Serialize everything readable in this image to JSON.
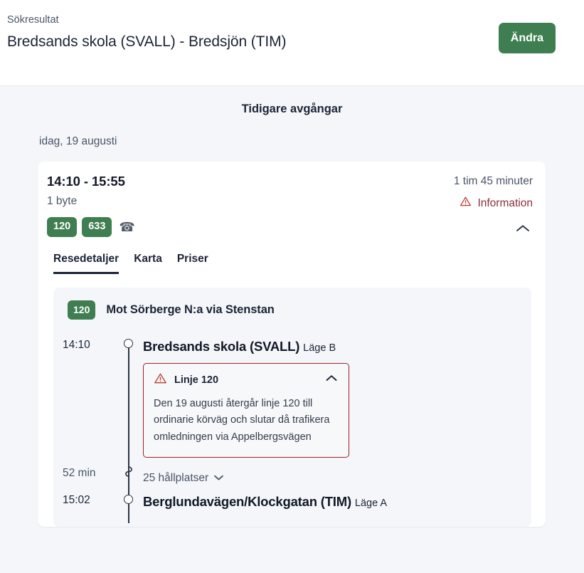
{
  "header": {
    "kicker": "Sökresultat",
    "search_title": "Bredsands skola (SVALL) - Bredsjön (TIM)",
    "change_button": "Ändra",
    "accent_green": "#3f7e51"
  },
  "results": {
    "earlier_departures": "Tidigare avgångar",
    "day_label": "idag, 19 augusti",
    "panel_background": "#f4f6f9"
  },
  "trip": {
    "times": "14:10 - 15:55",
    "changes": "1 byte",
    "duration": "1 tim 45 minuter",
    "info_label": "Information",
    "info_color": "#8c2f3d",
    "line_badges": [
      {
        "label": "120"
      },
      {
        "label": "633"
      }
    ],
    "phone_icon": "telephone-icon",
    "collapse_icon": "chevron-up-icon",
    "tabs": [
      {
        "label": "Resedetaljer",
        "active": true
      },
      {
        "label": "Karta",
        "active": false
      },
      {
        "label": "Priser",
        "active": false
      }
    ]
  },
  "leg": {
    "line_badge": "120",
    "direction": "Mot Sörberge N:a via Stenstan",
    "departure": {
      "time": "14:10",
      "stop_name": "Bredsands skola (SVALL)",
      "platform": "Läge B"
    },
    "alert": {
      "title": "Linje 120",
      "body": "Den 19 augusti återgår linje 120 till ordinarie körväg och slutar då trafikera omledningen via Appelbergsvägen",
      "warning_icon": "warning-triangle-icon",
      "collapse_icon": "chevron-up-icon",
      "border_color": "#9b2226"
    },
    "ride": {
      "duration": "52 min",
      "stops_label": "25 hållplatser",
      "expand_icon": "chevron-down-icon"
    },
    "arrival": {
      "time": "15:02",
      "stop_name": "Berglundavägen/Klockgatan (TIM)",
      "platform": "Läge A"
    }
  }
}
